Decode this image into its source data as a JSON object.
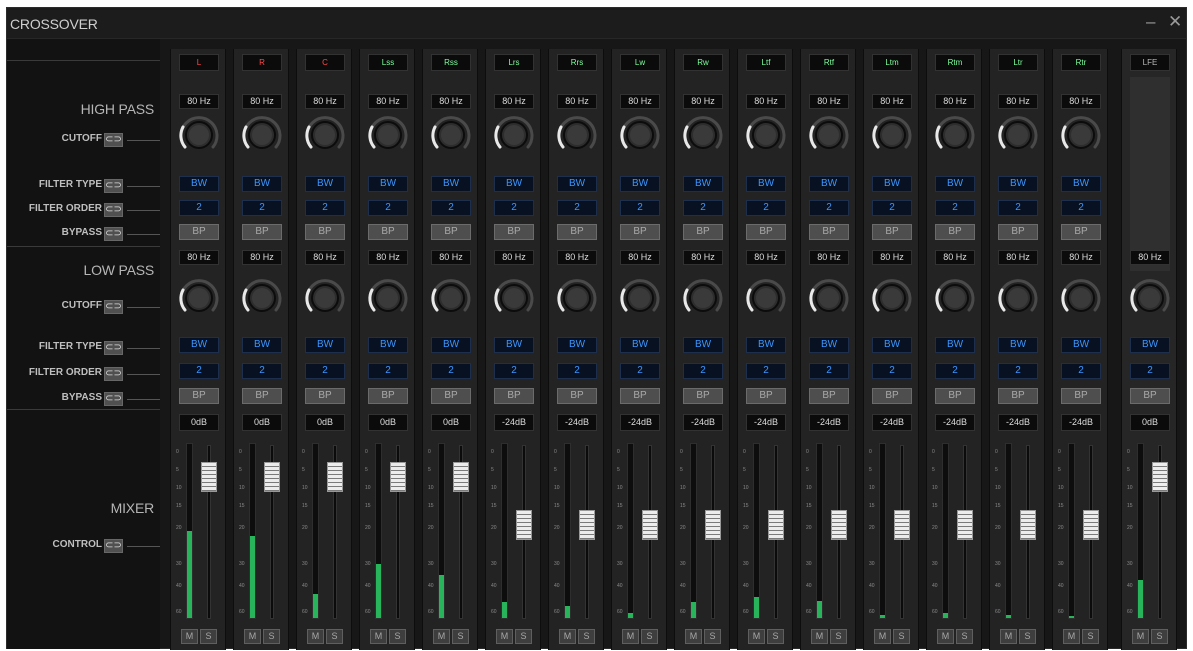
{
  "window": {
    "title": "CROSSOVER",
    "minimize": "–",
    "close": "✕"
  },
  "sidebar": {
    "high_pass": "HIGH PASS",
    "low_pass": "LOW PASS",
    "mixer": "MIXER",
    "cutoff": "CUTOFF",
    "filter_type": "FILTER TYPE",
    "filter_order": "FILTER ORDER",
    "bypass": "BYPASS",
    "control": "CONTROL",
    "link_icon": "link-icon"
  },
  "labels": {
    "bp": "BP",
    "mute": "M",
    "solo": "S"
  },
  "meter_scale": [
    "0",
    "5",
    "10",
    "15",
    "20",
    "30",
    "40",
    "60"
  ],
  "channels": [
    {
      "name": "L",
      "name_color": "#ff4a4a",
      "hp_freq": "80 Hz",
      "hp_type": "BW",
      "hp_order": "2",
      "lp_freq": "80 Hz",
      "lp_type": "BW",
      "lp_order": "2",
      "gain": "0dB",
      "fader_level": 0.88,
      "meter_level": 0.5
    },
    {
      "name": "R",
      "name_color": "#ff4a4a",
      "hp_freq": "80 Hz",
      "hp_type": "BW",
      "hp_order": "2",
      "lp_freq": "80 Hz",
      "lp_type": "BW",
      "lp_order": "2",
      "gain": "0dB",
      "fader_level": 0.88,
      "meter_level": 0.47
    },
    {
      "name": "C",
      "name_color": "#ff4a4a",
      "hp_freq": "80 Hz",
      "hp_type": "BW",
      "hp_order": "2",
      "lp_freq": "80 Hz",
      "lp_type": "BW",
      "lp_order": "2",
      "gain": "0dB",
      "fader_level": 0.88,
      "meter_level": 0.14
    },
    {
      "name": "Lss",
      "name_color": "#7dff9e",
      "hp_freq": "80 Hz",
      "hp_type": "BW",
      "hp_order": "2",
      "lp_freq": "80 Hz",
      "lp_type": "BW",
      "lp_order": "2",
      "gain": "0dB",
      "fader_level": 0.88,
      "meter_level": 0.31
    },
    {
      "name": "Rss",
      "name_color": "#7dff9e",
      "hp_freq": "80 Hz",
      "hp_type": "BW",
      "hp_order": "2",
      "lp_freq": "80 Hz",
      "lp_type": "BW",
      "lp_order": "2",
      "gain": "0dB",
      "fader_level": 0.88,
      "meter_level": 0.25
    },
    {
      "name": "Lrs",
      "name_color": "#7dff9e",
      "hp_freq": "80 Hz",
      "hp_type": "BW",
      "hp_order": "2",
      "lp_freq": "80 Hz",
      "lp_type": "BW",
      "lp_order": "2",
      "gain": "-24dB",
      "fader_level": 0.55,
      "meter_level": 0.09
    },
    {
      "name": "Rrs",
      "name_color": "#7dff9e",
      "hp_freq": "80 Hz",
      "hp_type": "BW",
      "hp_order": "2",
      "lp_freq": "80 Hz",
      "lp_type": "BW",
      "lp_order": "2",
      "gain": "-24dB",
      "fader_level": 0.55,
      "meter_level": 0.07
    },
    {
      "name": "Lw",
      "name_color": "#7dff9e",
      "hp_freq": "80 Hz",
      "hp_type": "BW",
      "hp_order": "2",
      "lp_freq": "80 Hz",
      "lp_type": "BW",
      "lp_order": "2",
      "gain": "-24dB",
      "fader_level": 0.55,
      "meter_level": 0.03
    },
    {
      "name": "Rw",
      "name_color": "#7dff9e",
      "hp_freq": "80 Hz",
      "hp_type": "BW",
      "hp_order": "2",
      "lp_freq": "80 Hz",
      "lp_type": "BW",
      "lp_order": "2",
      "gain": "-24dB",
      "fader_level": 0.55,
      "meter_level": 0.09
    },
    {
      "name": "Ltf",
      "name_color": "#7dff9e",
      "hp_freq": "80 Hz",
      "hp_type": "BW",
      "hp_order": "2",
      "lp_freq": "80 Hz",
      "lp_type": "BW",
      "lp_order": "2",
      "gain": "-24dB",
      "fader_level": 0.55,
      "meter_level": 0.12
    },
    {
      "name": "Rtf",
      "name_color": "#7dff9e",
      "hp_freq": "80 Hz",
      "hp_type": "BW",
      "hp_order": "2",
      "lp_freq": "80 Hz",
      "lp_type": "BW",
      "lp_order": "2",
      "gain": "-24dB",
      "fader_level": 0.55,
      "meter_level": 0.1
    },
    {
      "name": "Ltm",
      "name_color": "#7dff9e",
      "hp_freq": "80 Hz",
      "hp_type": "BW",
      "hp_order": "2",
      "lp_freq": "80 Hz",
      "lp_type": "BW",
      "lp_order": "2",
      "gain": "-24dB",
      "fader_level": 0.55,
      "meter_level": 0.02
    },
    {
      "name": "Rtm",
      "name_color": "#7dff9e",
      "hp_freq": "80 Hz",
      "hp_type": "BW",
      "hp_order": "2",
      "lp_freq": "80 Hz",
      "lp_type": "BW",
      "lp_order": "2",
      "gain": "-24dB",
      "fader_level": 0.55,
      "meter_level": 0.03
    },
    {
      "name": "Ltr",
      "name_color": "#7dff9e",
      "hp_freq": "80 Hz",
      "hp_type": "BW",
      "hp_order": "2",
      "lp_freq": "80 Hz",
      "lp_type": "BW",
      "lp_order": "2",
      "gain": "-24dB",
      "fader_level": 0.55,
      "meter_level": 0.02
    },
    {
      "name": "Rtr",
      "name_color": "#7dff9e",
      "hp_freq": "80 Hz",
      "hp_type": "BW",
      "hp_order": "2",
      "lp_freq": "80 Hz",
      "lp_type": "BW",
      "lp_order": "2",
      "gain": "-24dB",
      "fader_level": 0.55,
      "meter_level": 0.01
    }
  ],
  "lfe": {
    "name": "LFE",
    "name_color": "#b8b8b8",
    "lp_freq": "80 Hz",
    "lp_type": "BW",
    "lp_order": "2",
    "gain": "0dB",
    "fader_level": 0.88,
    "meter_level": 0.22
  }
}
